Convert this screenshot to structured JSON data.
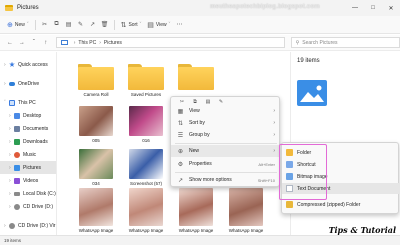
{
  "window": {
    "title": "Pictures"
  },
  "watermark": "meutheapotechbiplog.blogspot.com",
  "toolbar": {
    "new_label": "New",
    "sort_label": "Sort",
    "view_label": "View"
  },
  "address": {
    "crumbs": [
      "This PC",
      "Pictures"
    ],
    "search_placeholder": "Search Pictures"
  },
  "sidebar": {
    "items": [
      {
        "label": "Quick access",
        "color": "#3a7be0"
      },
      {
        "label": "OneDrive",
        "color": "#2f7fd8"
      },
      {
        "label": "This PC",
        "color": "#3a7be0"
      },
      {
        "label": "Desktop",
        "color": "#4a8ae6"
      },
      {
        "label": "Documents",
        "color": "#6b7fa0"
      },
      {
        "label": "Downloads",
        "color": "#2d9d52"
      },
      {
        "label": "Music",
        "color": "#e05a3a"
      },
      {
        "label": "Pictures",
        "color": "#3a8ee6"
      },
      {
        "label": "Videos",
        "color": "#8a4fd6"
      },
      {
        "label": "Local Disk (C:)",
        "color": "#8a8a8a"
      },
      {
        "label": "CD Drive (D:)",
        "color": "#8a8a8a"
      },
      {
        "label": "CD Drive (D:) Vir",
        "color": "#8a8a8a"
      }
    ]
  },
  "content": {
    "tiles": [
      {
        "label": "Camera Roll",
        "kind": "folder"
      },
      {
        "label": "Saved Pictures",
        "kind": "folder"
      },
      {
        "label": "",
        "kind": "folder"
      },
      {
        "label": "005",
        "kind": "photo"
      },
      {
        "label": "016",
        "kind": "photo"
      },
      {
        "label": "034",
        "kind": "photo"
      },
      {
        "label": "Screenshot (57)",
        "kind": "photo"
      },
      {
        "label": "WhatsApp Image",
        "kind": "photo"
      },
      {
        "label": "WhatsApp Image",
        "kind": "photo"
      },
      {
        "label": "WhatsApp Image",
        "kind": "photo"
      },
      {
        "label": "WhatsApp Image",
        "kind": "photo"
      }
    ]
  },
  "details": {
    "count": "19 items"
  },
  "statusbar": {
    "text": "19 items"
  },
  "context_menu": {
    "items": [
      {
        "label": "View",
        "icon": "grid-icon"
      },
      {
        "label": "Sort by",
        "icon": "sort-icon"
      },
      {
        "label": "Group by",
        "icon": "group-icon"
      },
      {
        "label": "New",
        "icon": "new-icon"
      },
      {
        "label": "Properties",
        "icon": "properties-icon",
        "shortcut": "Alt+Enter"
      },
      {
        "label": "Show more options",
        "icon": "more-options-icon",
        "shortcut": "Shift+F10"
      }
    ]
  },
  "submenu": {
    "items": [
      {
        "label": "Folder",
        "color": "#f2b93b"
      },
      {
        "label": "Shortcut",
        "color": "#7aa8e8"
      },
      {
        "label": "Bitmap image",
        "color": "#6aa3e6"
      },
      {
        "label": "Text Document",
        "color": "#b0b8c4"
      },
      {
        "label": "Compressed (zipped) Folder",
        "color": "#e8b73a"
      }
    ]
  },
  "badge": "Tips & Tutorial"
}
